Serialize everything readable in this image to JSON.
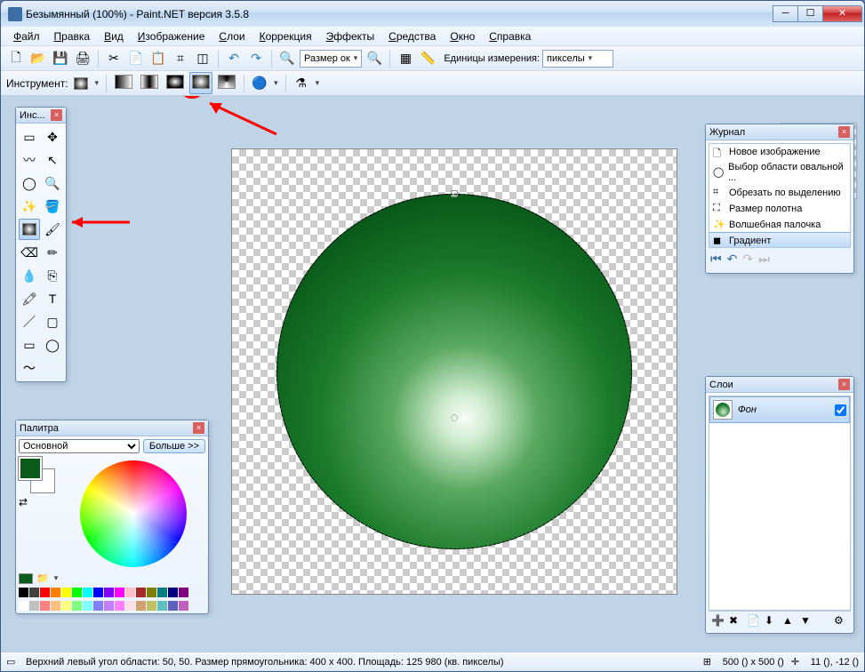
{
  "title": "Безымянный (100%) - Paint.NET версия 3.5.8",
  "menu": {
    "file": "Файл",
    "edit": "Правка",
    "view": "Вид",
    "image": "Изображение",
    "layers": "Слои",
    "correction": "Коррекция",
    "effects": "Эффекты",
    "tools": "Средства",
    "window": "Окно",
    "help": "Справка"
  },
  "toolbar": {
    "size": "Размер ок",
    "units_label": "Единицы измерения:",
    "units": "пикселы"
  },
  "toolbar2": {
    "label": "Инструмент:"
  },
  "tools_panel": {
    "title": "Инс..."
  },
  "history": {
    "title": "Журнал",
    "items": [
      "Новое изображение",
      "Выбор области овальной ...",
      "Обрезать по выделению",
      "Размер полотна",
      "Волшебная палочка",
      "Градиент"
    ]
  },
  "layers": {
    "title": "Слои",
    "layer": "Фон"
  },
  "palette": {
    "title": "Палитра",
    "mode": "Основной",
    "more": "Больше >>",
    "colors_row1": [
      "#000",
      "#404040",
      "#f00",
      "#ff8000",
      "#ff0",
      "#0f0",
      "#0ff",
      "#00f",
      "#8000ff",
      "#f0f",
      "#ffc0cb",
      "#a52a2a",
      "#808000",
      "#008080",
      "#000080",
      "#800080"
    ],
    "colors_row2": [
      "#fff",
      "#c0c0c0",
      "#ff8080",
      "#ffc080",
      "#ffff80",
      "#80ff80",
      "#80ffff",
      "#8080ff",
      "#c080ff",
      "#ff80ff",
      "#ffe0e8",
      "#d2a070",
      "#c0c060",
      "#60c0c0",
      "#6060c0",
      "#c060c0"
    ]
  },
  "status": {
    "text": "Верхний левый угол области: 50, 50. Размер прямоугольника: 400 x 400. Площадь: 125 980 (кв. пикселы)",
    "size": "500 () x 500 ()",
    "pos": "11 (), -12 ()"
  }
}
